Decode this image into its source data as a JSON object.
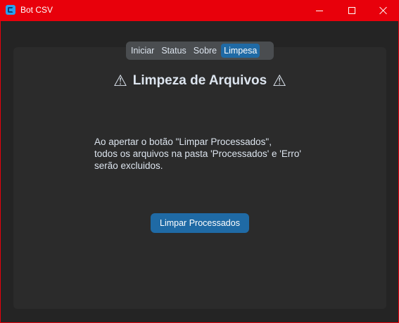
{
  "window": {
    "title": "Bot CSV",
    "title_bar_color": "#e8000b"
  },
  "tabs": [
    {
      "label": "Iniciar",
      "active": false
    },
    {
      "label": "Status",
      "active": false
    },
    {
      "label": "Sobre",
      "active": false
    },
    {
      "label": "Limpesa",
      "active": true
    }
  ],
  "panel": {
    "heading": "Limpeza de Arquivos",
    "warning_icon": "⚠",
    "description": "Ao apertar o botão \"Limpar Processados\",\ntodos os arquivos na pasta 'Processados' e 'Erro'\nserão excluidos.",
    "button_label": "Limpar Processados"
  },
  "colors": {
    "accent": "#1f6aa5",
    "background": "#242424",
    "panel": "#2b2b2b",
    "text": "#dce4ee"
  }
}
